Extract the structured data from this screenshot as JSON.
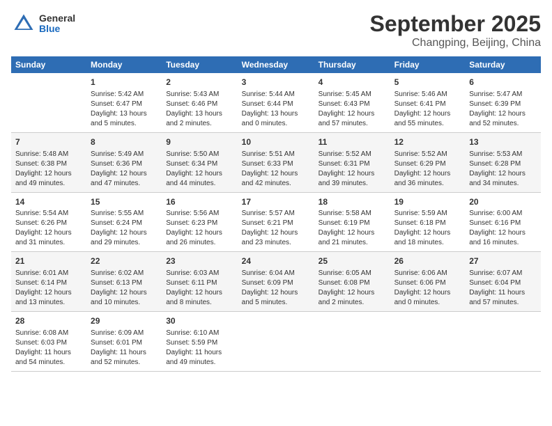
{
  "header": {
    "logo_general": "General",
    "logo_blue": "Blue",
    "title": "September 2025",
    "subtitle": "Changping, Beijing, China"
  },
  "columns": [
    "Sunday",
    "Monday",
    "Tuesday",
    "Wednesday",
    "Thursday",
    "Friday",
    "Saturday"
  ],
  "weeks": [
    [
      {
        "day": "",
        "info": ""
      },
      {
        "day": "1",
        "info": "Sunrise: 5:42 AM\nSunset: 6:47 PM\nDaylight: 13 hours\nand 5 minutes."
      },
      {
        "day": "2",
        "info": "Sunrise: 5:43 AM\nSunset: 6:46 PM\nDaylight: 13 hours\nand 2 minutes."
      },
      {
        "day": "3",
        "info": "Sunrise: 5:44 AM\nSunset: 6:44 PM\nDaylight: 13 hours\nand 0 minutes."
      },
      {
        "day": "4",
        "info": "Sunrise: 5:45 AM\nSunset: 6:43 PM\nDaylight: 12 hours\nand 57 minutes."
      },
      {
        "day": "5",
        "info": "Sunrise: 5:46 AM\nSunset: 6:41 PM\nDaylight: 12 hours\nand 55 minutes."
      },
      {
        "day": "6",
        "info": "Sunrise: 5:47 AM\nSunset: 6:39 PM\nDaylight: 12 hours\nand 52 minutes."
      }
    ],
    [
      {
        "day": "7",
        "info": "Sunrise: 5:48 AM\nSunset: 6:38 PM\nDaylight: 12 hours\nand 49 minutes."
      },
      {
        "day": "8",
        "info": "Sunrise: 5:49 AM\nSunset: 6:36 PM\nDaylight: 12 hours\nand 47 minutes."
      },
      {
        "day": "9",
        "info": "Sunrise: 5:50 AM\nSunset: 6:34 PM\nDaylight: 12 hours\nand 44 minutes."
      },
      {
        "day": "10",
        "info": "Sunrise: 5:51 AM\nSunset: 6:33 PM\nDaylight: 12 hours\nand 42 minutes."
      },
      {
        "day": "11",
        "info": "Sunrise: 5:52 AM\nSunset: 6:31 PM\nDaylight: 12 hours\nand 39 minutes."
      },
      {
        "day": "12",
        "info": "Sunrise: 5:52 AM\nSunset: 6:29 PM\nDaylight: 12 hours\nand 36 minutes."
      },
      {
        "day": "13",
        "info": "Sunrise: 5:53 AM\nSunset: 6:28 PM\nDaylight: 12 hours\nand 34 minutes."
      }
    ],
    [
      {
        "day": "14",
        "info": "Sunrise: 5:54 AM\nSunset: 6:26 PM\nDaylight: 12 hours\nand 31 minutes."
      },
      {
        "day": "15",
        "info": "Sunrise: 5:55 AM\nSunset: 6:24 PM\nDaylight: 12 hours\nand 29 minutes."
      },
      {
        "day": "16",
        "info": "Sunrise: 5:56 AM\nSunset: 6:23 PM\nDaylight: 12 hours\nand 26 minutes."
      },
      {
        "day": "17",
        "info": "Sunrise: 5:57 AM\nSunset: 6:21 PM\nDaylight: 12 hours\nand 23 minutes."
      },
      {
        "day": "18",
        "info": "Sunrise: 5:58 AM\nSunset: 6:19 PM\nDaylight: 12 hours\nand 21 minutes."
      },
      {
        "day": "19",
        "info": "Sunrise: 5:59 AM\nSunset: 6:18 PM\nDaylight: 12 hours\nand 18 minutes."
      },
      {
        "day": "20",
        "info": "Sunrise: 6:00 AM\nSunset: 6:16 PM\nDaylight: 12 hours\nand 16 minutes."
      }
    ],
    [
      {
        "day": "21",
        "info": "Sunrise: 6:01 AM\nSunset: 6:14 PM\nDaylight: 12 hours\nand 13 minutes."
      },
      {
        "day": "22",
        "info": "Sunrise: 6:02 AM\nSunset: 6:13 PM\nDaylight: 12 hours\nand 10 minutes."
      },
      {
        "day": "23",
        "info": "Sunrise: 6:03 AM\nSunset: 6:11 PM\nDaylight: 12 hours\nand 8 minutes."
      },
      {
        "day": "24",
        "info": "Sunrise: 6:04 AM\nSunset: 6:09 PM\nDaylight: 12 hours\nand 5 minutes."
      },
      {
        "day": "25",
        "info": "Sunrise: 6:05 AM\nSunset: 6:08 PM\nDaylight: 12 hours\nand 2 minutes."
      },
      {
        "day": "26",
        "info": "Sunrise: 6:06 AM\nSunset: 6:06 PM\nDaylight: 12 hours\nand 0 minutes."
      },
      {
        "day": "27",
        "info": "Sunrise: 6:07 AM\nSunset: 6:04 PM\nDaylight: 11 hours\nand 57 minutes."
      }
    ],
    [
      {
        "day": "28",
        "info": "Sunrise: 6:08 AM\nSunset: 6:03 PM\nDaylight: 11 hours\nand 54 minutes."
      },
      {
        "day": "29",
        "info": "Sunrise: 6:09 AM\nSunset: 6:01 PM\nDaylight: 11 hours\nand 52 minutes."
      },
      {
        "day": "30",
        "info": "Sunrise: 6:10 AM\nSunset: 5:59 PM\nDaylight: 11 hours\nand 49 minutes."
      },
      {
        "day": "",
        "info": ""
      },
      {
        "day": "",
        "info": ""
      },
      {
        "day": "",
        "info": ""
      },
      {
        "day": "",
        "info": ""
      }
    ]
  ]
}
